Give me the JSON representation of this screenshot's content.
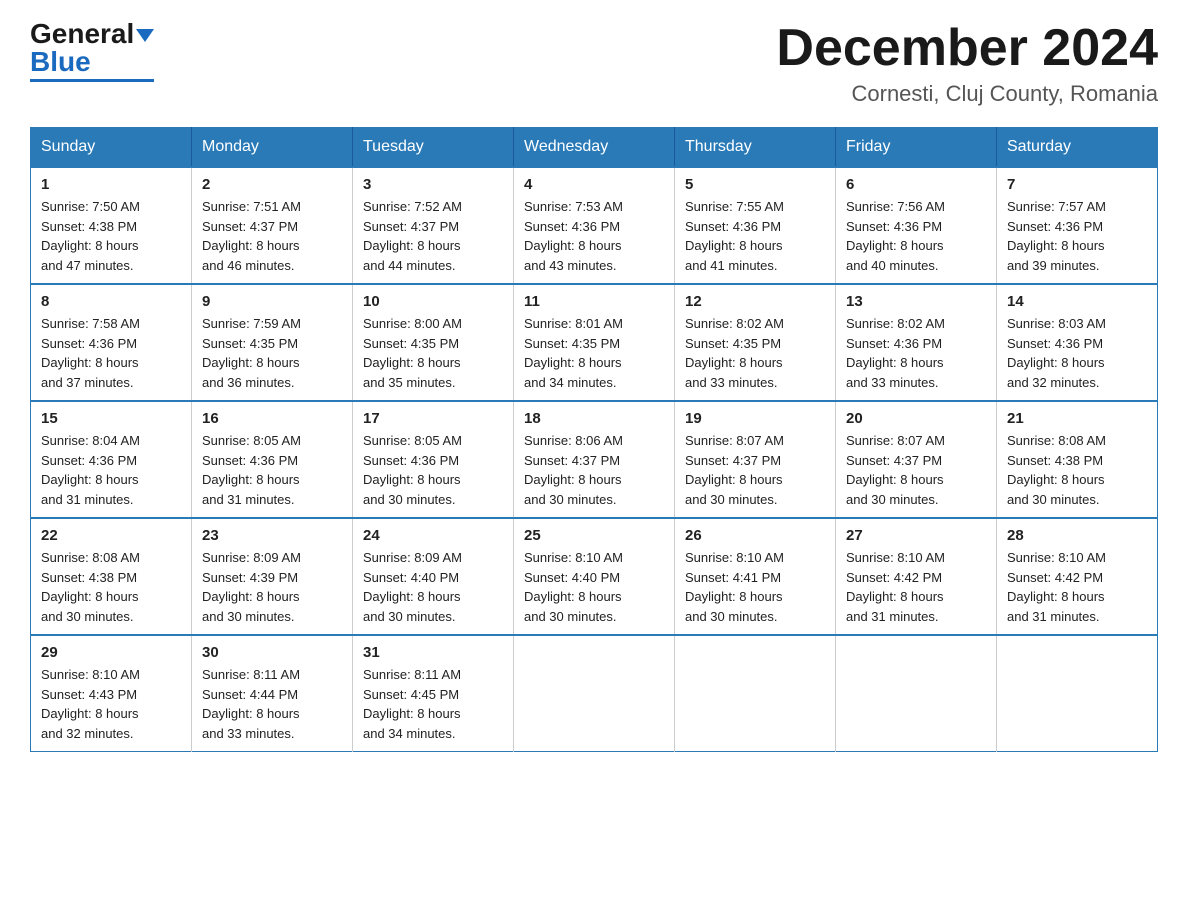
{
  "logo": {
    "general": "General",
    "blue": "Blue"
  },
  "title": "December 2024",
  "subtitle": "Cornesti, Cluj County, Romania",
  "days_of_week": [
    "Sunday",
    "Monday",
    "Tuesday",
    "Wednesday",
    "Thursday",
    "Friday",
    "Saturday"
  ],
  "weeks": [
    [
      {
        "day": "1",
        "sunrise": "7:50 AM",
        "sunset": "4:38 PM",
        "daylight": "8 hours and 47 minutes."
      },
      {
        "day": "2",
        "sunrise": "7:51 AM",
        "sunset": "4:37 PM",
        "daylight": "8 hours and 46 minutes."
      },
      {
        "day": "3",
        "sunrise": "7:52 AM",
        "sunset": "4:37 PM",
        "daylight": "8 hours and 44 minutes."
      },
      {
        "day": "4",
        "sunrise": "7:53 AM",
        "sunset": "4:36 PM",
        "daylight": "8 hours and 43 minutes."
      },
      {
        "day": "5",
        "sunrise": "7:55 AM",
        "sunset": "4:36 PM",
        "daylight": "8 hours and 41 minutes."
      },
      {
        "day": "6",
        "sunrise": "7:56 AM",
        "sunset": "4:36 PM",
        "daylight": "8 hours and 40 minutes."
      },
      {
        "day": "7",
        "sunrise": "7:57 AM",
        "sunset": "4:36 PM",
        "daylight": "8 hours and 39 minutes."
      }
    ],
    [
      {
        "day": "8",
        "sunrise": "7:58 AM",
        "sunset": "4:36 PM",
        "daylight": "8 hours and 37 minutes."
      },
      {
        "day": "9",
        "sunrise": "7:59 AM",
        "sunset": "4:35 PM",
        "daylight": "8 hours and 36 minutes."
      },
      {
        "day": "10",
        "sunrise": "8:00 AM",
        "sunset": "4:35 PM",
        "daylight": "8 hours and 35 minutes."
      },
      {
        "day": "11",
        "sunrise": "8:01 AM",
        "sunset": "4:35 PM",
        "daylight": "8 hours and 34 minutes."
      },
      {
        "day": "12",
        "sunrise": "8:02 AM",
        "sunset": "4:35 PM",
        "daylight": "8 hours and 33 minutes."
      },
      {
        "day": "13",
        "sunrise": "8:02 AM",
        "sunset": "4:36 PM",
        "daylight": "8 hours and 33 minutes."
      },
      {
        "day": "14",
        "sunrise": "8:03 AM",
        "sunset": "4:36 PM",
        "daylight": "8 hours and 32 minutes."
      }
    ],
    [
      {
        "day": "15",
        "sunrise": "8:04 AM",
        "sunset": "4:36 PM",
        "daylight": "8 hours and 31 minutes."
      },
      {
        "day": "16",
        "sunrise": "8:05 AM",
        "sunset": "4:36 PM",
        "daylight": "8 hours and 31 minutes."
      },
      {
        "day": "17",
        "sunrise": "8:05 AM",
        "sunset": "4:36 PM",
        "daylight": "8 hours and 30 minutes."
      },
      {
        "day": "18",
        "sunrise": "8:06 AM",
        "sunset": "4:37 PM",
        "daylight": "8 hours and 30 minutes."
      },
      {
        "day": "19",
        "sunrise": "8:07 AM",
        "sunset": "4:37 PM",
        "daylight": "8 hours and 30 minutes."
      },
      {
        "day": "20",
        "sunrise": "8:07 AM",
        "sunset": "4:37 PM",
        "daylight": "8 hours and 30 minutes."
      },
      {
        "day": "21",
        "sunrise": "8:08 AM",
        "sunset": "4:38 PM",
        "daylight": "8 hours and 30 minutes."
      }
    ],
    [
      {
        "day": "22",
        "sunrise": "8:08 AM",
        "sunset": "4:38 PM",
        "daylight": "8 hours and 30 minutes."
      },
      {
        "day": "23",
        "sunrise": "8:09 AM",
        "sunset": "4:39 PM",
        "daylight": "8 hours and 30 minutes."
      },
      {
        "day": "24",
        "sunrise": "8:09 AM",
        "sunset": "4:40 PM",
        "daylight": "8 hours and 30 minutes."
      },
      {
        "day": "25",
        "sunrise": "8:10 AM",
        "sunset": "4:40 PM",
        "daylight": "8 hours and 30 minutes."
      },
      {
        "day": "26",
        "sunrise": "8:10 AM",
        "sunset": "4:41 PM",
        "daylight": "8 hours and 30 minutes."
      },
      {
        "day": "27",
        "sunrise": "8:10 AM",
        "sunset": "4:42 PM",
        "daylight": "8 hours and 31 minutes."
      },
      {
        "day": "28",
        "sunrise": "8:10 AM",
        "sunset": "4:42 PM",
        "daylight": "8 hours and 31 minutes."
      }
    ],
    [
      {
        "day": "29",
        "sunrise": "8:10 AM",
        "sunset": "4:43 PM",
        "daylight": "8 hours and 32 minutes."
      },
      {
        "day": "30",
        "sunrise": "8:11 AM",
        "sunset": "4:44 PM",
        "daylight": "8 hours and 33 minutes."
      },
      {
        "day": "31",
        "sunrise": "8:11 AM",
        "sunset": "4:45 PM",
        "daylight": "8 hours and 34 minutes."
      },
      null,
      null,
      null,
      null
    ]
  ]
}
